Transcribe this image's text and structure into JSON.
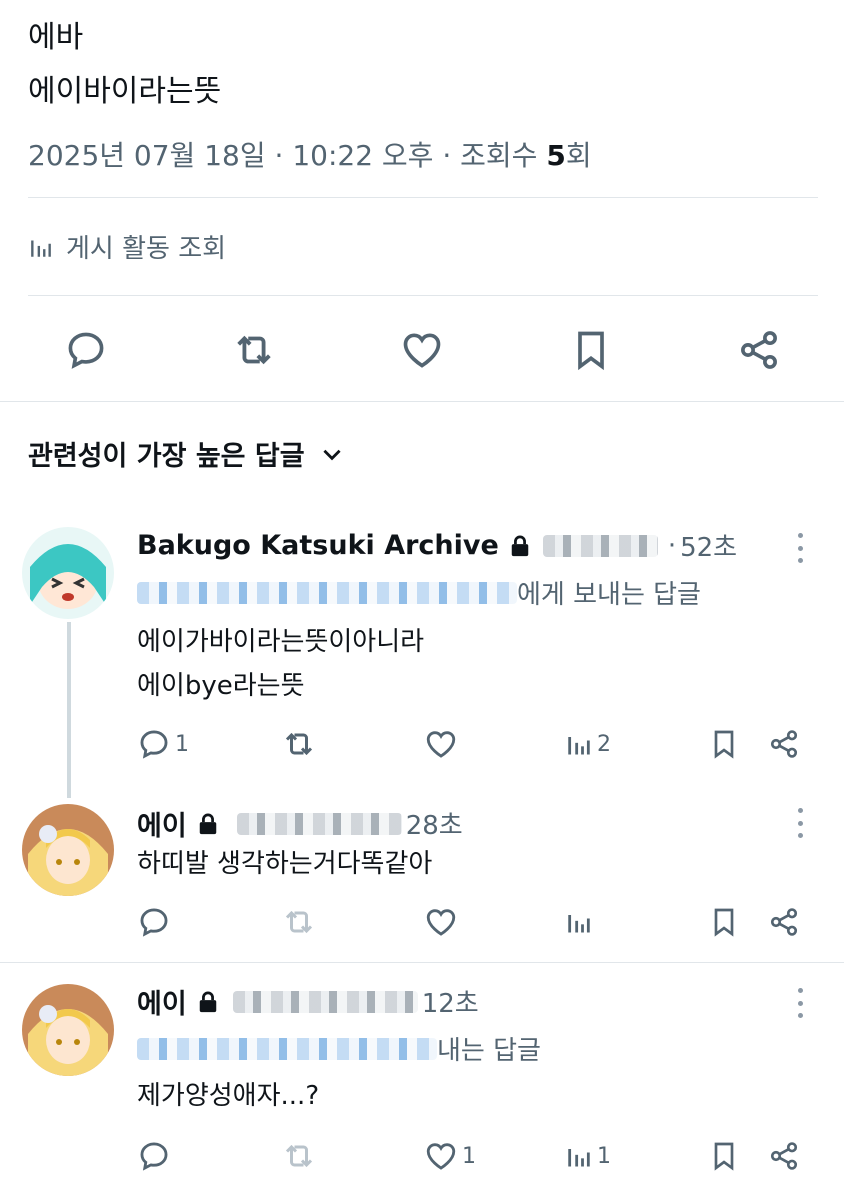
{
  "post": {
    "line1": "에바",
    "line2": "에이바이라는뜻",
    "date": "2025년 07월 18일",
    "sep": " · ",
    "time": "10:22 오후",
    "views_label": "조회수 ",
    "views_count": "5",
    "views_suffix": "회",
    "activity_label": "게시 활동 조회"
  },
  "actions": [
    "reply-icon",
    "repost-icon",
    "like-icon",
    "bookmark-icon",
    "share-icon"
  ],
  "sort_label": "관련성이 가장 높은 답글",
  "replies": [
    {
      "name": "Bakugo Katsuki Archive",
      "handle_sep": "·",
      "time": "52초",
      "reply_to_suffix": "에게 보내는 답글",
      "text1": "에이가바이라는뜻이아니라",
      "text2": "에이bye라는뜻",
      "reply_count": "1",
      "repost_count": "",
      "like_count": "",
      "view_count": "2"
    },
    {
      "name": "에이",
      "time": "28초",
      "text1": "하띠발 생각하는거다똑같아",
      "reply_count": "",
      "repost_count": "",
      "like_count": "",
      "view_count": ""
    },
    {
      "name": "에이",
      "time": "12초",
      "reply_to_suffix": "내는 답글",
      "text1": "제가양성애자...?",
      "reply_count": "",
      "repost_count": "",
      "like_count": "1",
      "view_count": "1"
    }
  ],
  "colors": {
    "text": "#0f1419",
    "secondary": "#536471",
    "divider": "#e1e6ea"
  }
}
